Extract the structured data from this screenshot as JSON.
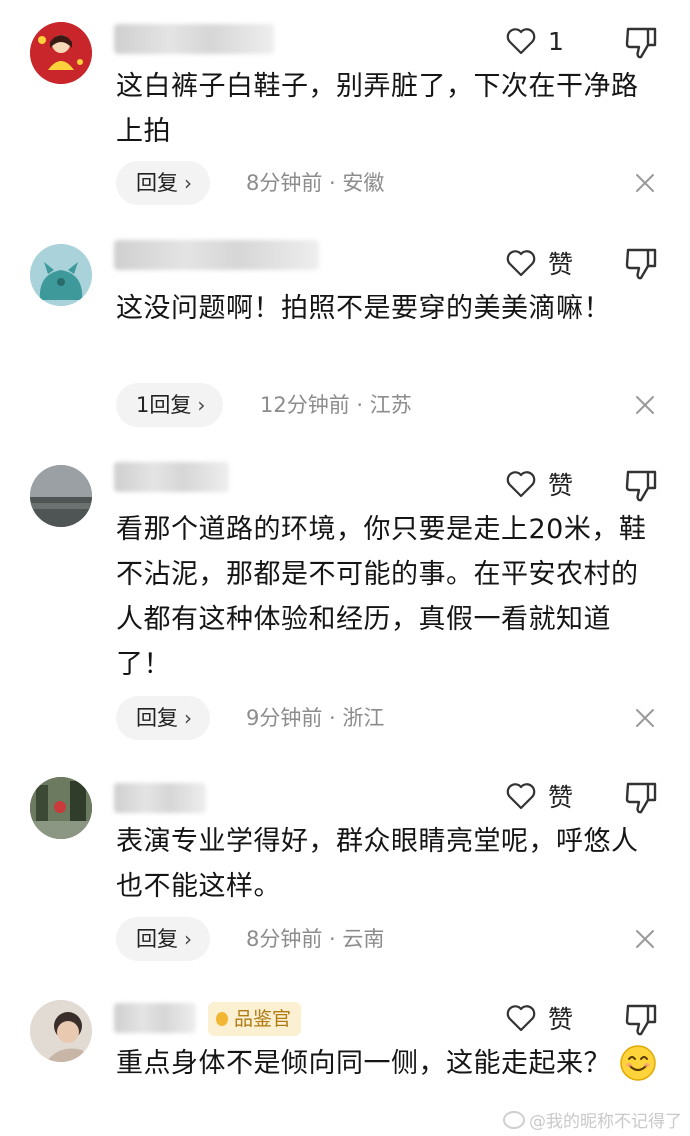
{
  "comments": [
    {
      "like_label": "1",
      "text": "这白裤子白鞋子，别弄脏了，下次在干净路上拍",
      "reply_label": "回复",
      "meta": "8分钟前 · 安徽"
    },
    {
      "like_label": "赞",
      "text": "这没问题啊！拍照不是要穿的美美滴嘛！",
      "reply_label": "1回复",
      "meta": "12分钟前 · 江苏"
    },
    {
      "like_label": "赞",
      "text": "看那个道路的环境，你只要是走上20米，鞋不沾泥，那都是不可能的事。在平安农村的人都有这种体验和经历，真假一看就知道了！",
      "reply_label": "回复",
      "meta": "9分钟前 · 浙江"
    },
    {
      "like_label": "赞",
      "text": "表演专业学得好，群众眼睛亮堂呢，呼悠人也不能这样。",
      "reply_label": "回复",
      "meta": "8分钟前 · 云南"
    },
    {
      "like_label": "赞",
      "text": "重点身体不是倾向同一侧，这能走起来？",
      "badge": "品鉴官"
    }
  ],
  "icons": {
    "like": "heart-outline-icon",
    "dislike": "thumbs-down-icon",
    "chevron": "chevron-right-icon",
    "close": "close-icon",
    "emoji": "smiling-emoji-icon"
  },
  "watermark": "@我的昵称不记得了",
  "colors": {
    "meta_gray": "#8c8c8c",
    "reply_bg": "#f3f3f3",
    "badge_bg": "#fbf0d2",
    "badge_text": "#b07a14"
  }
}
